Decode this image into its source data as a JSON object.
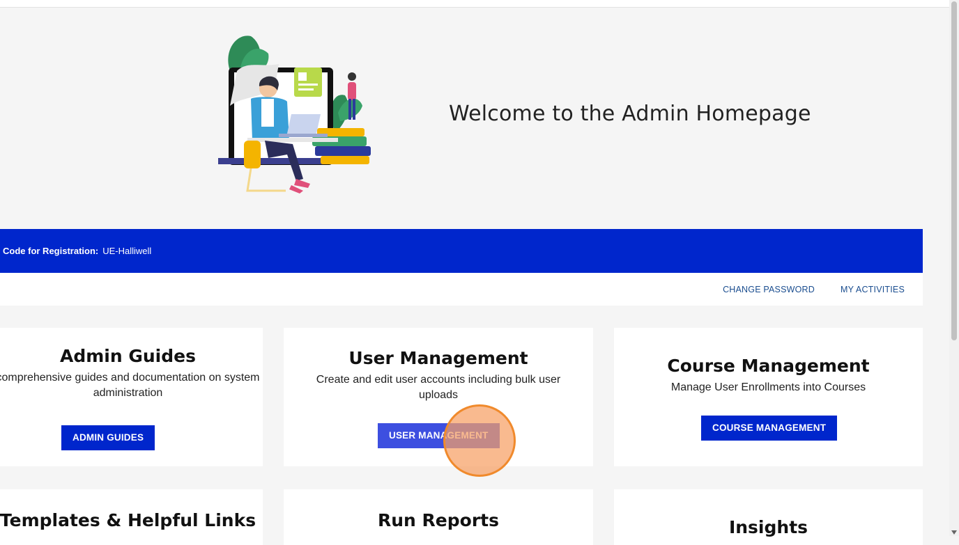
{
  "hero": {
    "title": "Welcome to the Admin Homepage",
    "illustration_icon": "person-at-laptop-illustration"
  },
  "registration": {
    "label": "Code for Registration:",
    "code": "UE-Halliwell",
    "color": "#0026cc"
  },
  "links": {
    "change_password": "CHANGE PASSWORD",
    "my_activities": "MY ACTIVITIES"
  },
  "cards": {
    "admin_guides": {
      "title": "Admin Guides",
      "description": "comprehensive guides and documentation on system administration",
      "button": "ADMIN GUIDES"
    },
    "user_management": {
      "title": "User Management",
      "description": "Create and edit user accounts including bulk user uploads",
      "button": "USER MANAGEMENT"
    },
    "course_management": {
      "title": "Course Management",
      "description": "Manage User Enrollments into Courses",
      "button": "COURSE MANAGEMENT"
    },
    "templates": {
      "title": "Templates & Helpful Links"
    },
    "run_reports": {
      "title": "Run Reports"
    },
    "insights": {
      "title": "Insights"
    }
  },
  "colors": {
    "primary": "#0026cc",
    "link": "#1a4d8f",
    "click_indicator": "#f08a2c"
  }
}
